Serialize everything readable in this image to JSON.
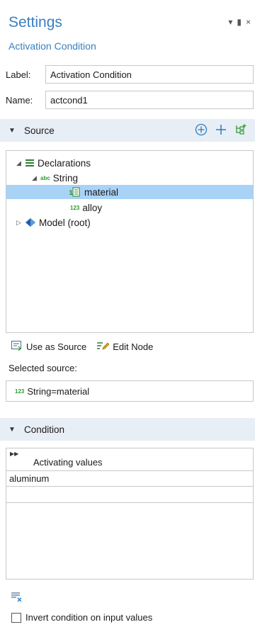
{
  "header": {
    "title": "Settings",
    "subtitle": "Activation Condition",
    "controls": {
      "menu": "▾",
      "pin": "▮",
      "close": "×"
    }
  },
  "form": {
    "label_label": "Label:",
    "label_value": "Activation Condition",
    "name_label": "Name:",
    "name_value": "actcond1"
  },
  "source_section": {
    "label": "Source",
    "tools": [
      "add-circle-icon",
      "add-icon",
      "tree-add-icon"
    ]
  },
  "tree": {
    "declarations": "Declarations",
    "string_node": "String",
    "string_badge": "abc",
    "material": "material",
    "alloy": "alloy",
    "alloy_badge": "123",
    "model": "Model (root)"
  },
  "actions": {
    "use_as_source": "Use as Source",
    "edit_node": "Edit Node"
  },
  "selected_source": {
    "label": "Selected source:",
    "badge": "123",
    "value": "String=material"
  },
  "condition_section": {
    "label": "Condition",
    "column_header": "Activating values",
    "rows": [
      "aluminum",
      ""
    ]
  },
  "footer": {
    "checkbox_label": "Invert condition on input values",
    "checked": false
  },
  "colors": {
    "accent": "#3a7fc1",
    "section_bg": "#e8eef5",
    "selection": "#a9d2f7",
    "badge_green": "#2e9b2e"
  }
}
